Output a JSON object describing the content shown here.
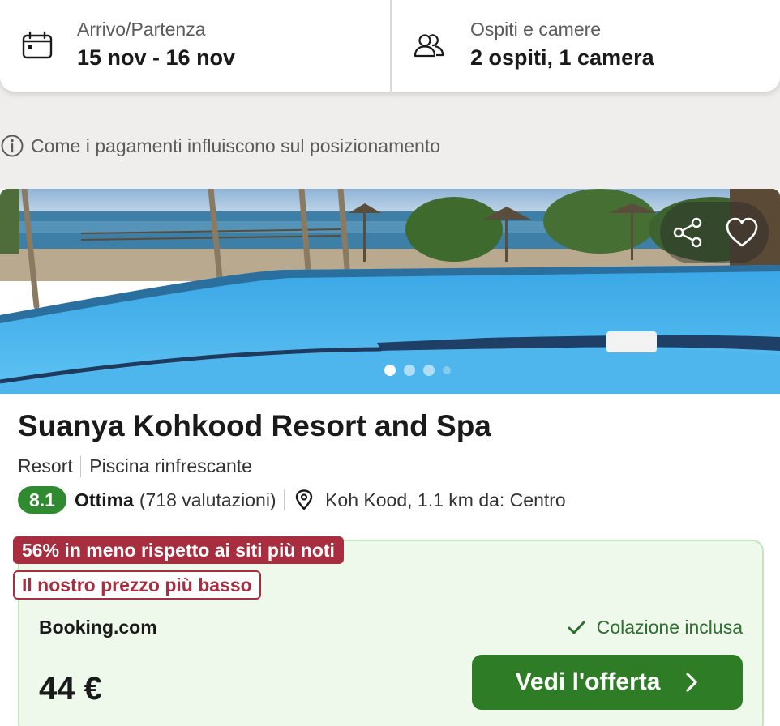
{
  "search": {
    "dates": {
      "label": "Arrivo/Partenza",
      "value": "15 nov - 16 nov",
      "icon": "calendar-icon"
    },
    "guests": {
      "label": "Ospiti e camere",
      "value": "2 ospiti, 1 camera",
      "icon": "users-icon"
    }
  },
  "info": {
    "text": "Come i pagamenti influiscono sul posizionamento",
    "icon": "info-icon"
  },
  "image": {
    "slides_total": 4,
    "active_slide": 1,
    "share_icon": "share-icon",
    "favorite_icon": "heart-icon"
  },
  "hotel": {
    "name": "Suanya Kohkood Resort and Spa",
    "type": "Resort",
    "feature": "Piscina rinfrescante",
    "rating_score": "8.1",
    "rating_word": "Ottima",
    "reviews": "(718 valutazioni)",
    "location": "Koh Kood, 1.1 km da: Centro"
  },
  "deal": {
    "discount_badge": "56% in meno rispetto ai siti più noti",
    "lowest_badge": "Il nostro prezzo più basso",
    "provider": "Booking.com",
    "amenity": "Colazione inclusa",
    "price": "44 €",
    "cta_label": "Vedi l'offerta"
  },
  "colors": {
    "rating_green": "#2f8a30",
    "discount_red": "#a82d3f",
    "cta_green": "#2e7d26",
    "deal_bg": "#eef9ec"
  }
}
